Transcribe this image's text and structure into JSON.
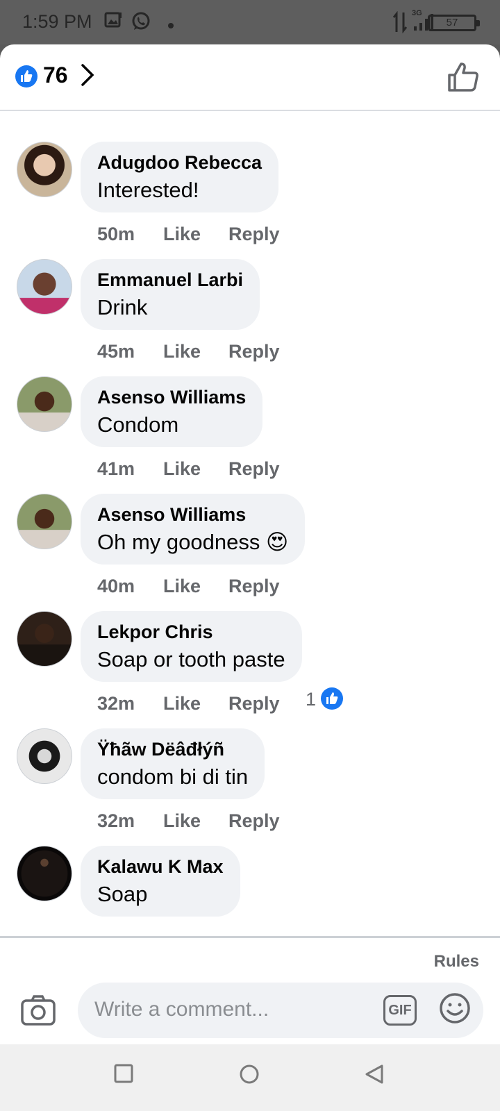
{
  "status_bar": {
    "time": "1:59 PM",
    "network": "3G",
    "battery": "57"
  },
  "reactions": {
    "count": "76"
  },
  "comments": [
    {
      "author": "Adugdoo Rebecca",
      "text": "Interested!",
      "time": "50m",
      "like": "Like",
      "reply": "Reply",
      "avatar_color": "#8a6a5a"
    },
    {
      "author": "Emmanuel Larbi",
      "text": "Drink",
      "time": "45m",
      "like": "Like",
      "reply": "Reply",
      "avatar_color": "#b0c4d8"
    },
    {
      "author": "Asenso Williams",
      "text": "Condom",
      "time": "41m",
      "like": "Like",
      "reply": "Reply",
      "avatar_color": "#7a8a5a"
    },
    {
      "author": "Asenso Williams",
      "text": "Oh my goodness 😍",
      "time": "40m",
      "like": "Like",
      "reply": "Reply",
      "avatar_color": "#7a8a5a"
    },
    {
      "author": "Lekpor Chris",
      "text": "Soap or tooth paste",
      "time": "32m",
      "like": "Like",
      "reply": "Reply",
      "reaction_count": "1",
      "avatar_color": "#2a1a14"
    },
    {
      "author": "Ÿħãw Dëâđłýñ",
      "text": "condom bi di tin",
      "time": "32m",
      "like": "Like",
      "reply": "Reply",
      "avatar_color": "#3a3a3a"
    },
    {
      "author": "Kalawu K Max",
      "text": "Soap",
      "avatar_color": "#1a1412"
    }
  ],
  "composer": {
    "rules_label": "Rules",
    "placeholder": "Write a comment...",
    "gif_label": "GIF"
  },
  "colors": {
    "accent": "#1877f2",
    "bubble": "#f0f2f5",
    "meta": "#65676b"
  }
}
